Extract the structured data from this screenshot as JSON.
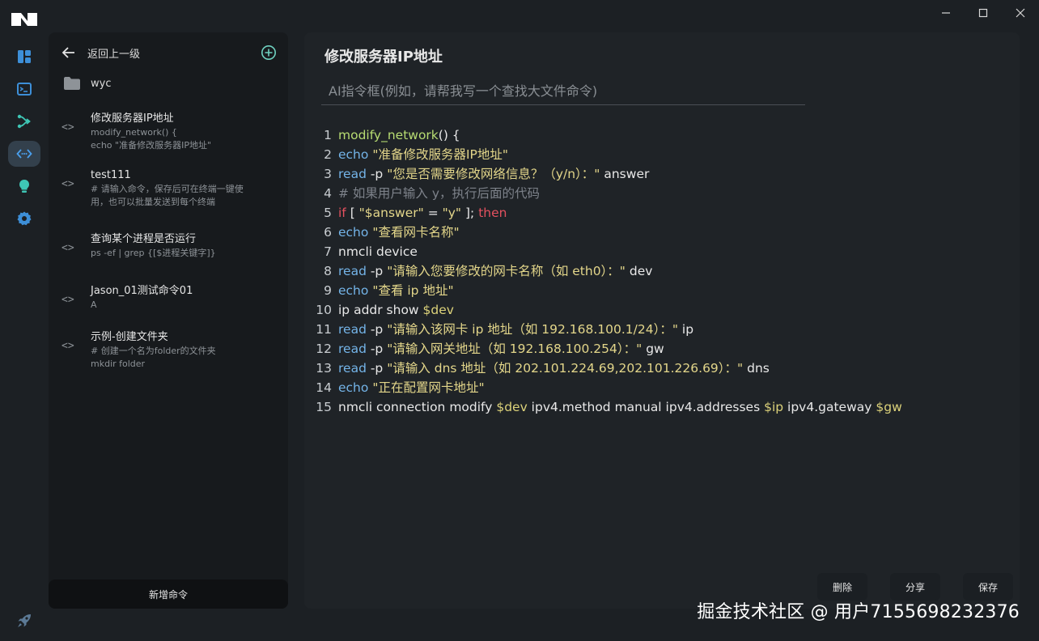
{
  "sidebar": {
    "back_label": "返回上一级",
    "folder_label": "wyc",
    "commands": [
      {
        "title": "修改服务器IP地址",
        "desc1": "modify_network() {",
        "desc2": "echo \"准备修改服务器IP地址\""
      },
      {
        "title": "test111",
        "desc1": "# 请输入命令，保存后可在终端一键使",
        "desc2": "用，也可以批量发送到每个终端"
      },
      {
        "title": "查询某个进程是否运行",
        "desc1": "ps -ef | grep {[$进程关键字]}",
        "desc2": ""
      },
      {
        "title": "Jason_01测试命令01",
        "desc1": "A",
        "desc2": ""
      },
      {
        "title": "示例-创建文件夹",
        "desc1": "# 创建一个名为folder的文件夹",
        "desc2": "mkdir folder"
      }
    ],
    "new_button": "新增命令"
  },
  "editor": {
    "title": "修改服务器IP地址",
    "ai_placeholder": "AI指令框(例如，请帮我写一个查找大文件命令)",
    "line_numbers": [
      "1",
      "2",
      "3",
      "4",
      "5",
      "6",
      "7",
      "8",
      "9",
      "10",
      "11",
      "12",
      "13",
      "14",
      "15"
    ],
    "lines": [
      [
        {
          "t": "fn",
          "s": "modify_network"
        },
        {
          "t": "tx",
          "s": "() {"
        }
      ],
      [
        {
          "t": "kw",
          "s": "echo"
        },
        {
          "t": "tx",
          "s": " "
        },
        {
          "t": "str",
          "s": "\"准备修改服务器IP地址\""
        }
      ],
      [
        {
          "t": "kw",
          "s": "read"
        },
        {
          "t": "tx",
          "s": " -p "
        },
        {
          "t": "str",
          "s": "\"您是否需要修改网络信息？（y/n）：\""
        },
        {
          "t": "tx",
          "s": " answer"
        }
      ],
      [
        {
          "t": "cm",
          "s": "# 如果用户输入 y，执行后面的代码"
        }
      ],
      [
        {
          "t": "red",
          "s": "if"
        },
        {
          "t": "tx",
          "s": " [ "
        },
        {
          "t": "str",
          "s": "\"$answer\""
        },
        {
          "t": "tx",
          "s": " = "
        },
        {
          "t": "str",
          "s": "\"y\""
        },
        {
          "t": "tx",
          "s": " ]; "
        },
        {
          "t": "red",
          "s": "then"
        }
      ],
      [
        {
          "t": "kw",
          "s": "echo"
        },
        {
          "t": "tx",
          "s": " "
        },
        {
          "t": "str",
          "s": "\"查看网卡名称\""
        }
      ],
      [
        {
          "t": "tx",
          "s": "nmcli device"
        }
      ],
      [
        {
          "t": "kw",
          "s": "read"
        },
        {
          "t": "tx",
          "s": " -p "
        },
        {
          "t": "str",
          "s": "\"请输入您要修改的网卡名称（如 eth0）：\""
        },
        {
          "t": "tx",
          "s": " dev"
        }
      ],
      [
        {
          "t": "kw",
          "s": "echo"
        },
        {
          "t": "tx",
          "s": " "
        },
        {
          "t": "str",
          "s": "\"查看 ip 地址\""
        }
      ],
      [
        {
          "t": "tx",
          "s": "ip addr show "
        },
        {
          "t": "var",
          "s": "$dev"
        }
      ],
      [
        {
          "t": "kw",
          "s": "read"
        },
        {
          "t": "tx",
          "s": " -p "
        },
        {
          "t": "str",
          "s": "\"请输入该网卡 ip 地址（如 192.168.100.1/24）：\""
        },
        {
          "t": "tx",
          "s": " ip"
        }
      ],
      [
        {
          "t": "kw",
          "s": "read"
        },
        {
          "t": "tx",
          "s": " -p "
        },
        {
          "t": "str",
          "s": "\"请输入网关地址（如 192.168.100.254）：\""
        },
        {
          "t": "tx",
          "s": " gw"
        }
      ],
      [
        {
          "t": "kw",
          "s": "read"
        },
        {
          "t": "tx",
          "s": " -p "
        },
        {
          "t": "str",
          "s": "\"请输入 dns 地址（如 202.101.224.69,202.101.226.69）：\""
        },
        {
          "t": "tx",
          "s": " dns"
        }
      ],
      [
        {
          "t": "kw",
          "s": "echo"
        },
        {
          "t": "tx",
          "s": " "
        },
        {
          "t": "str",
          "s": "\"正在配置网卡地址\""
        }
      ],
      [
        {
          "t": "tx",
          "s": "nmcli connection modify "
        },
        {
          "t": "var",
          "s": "$dev"
        },
        {
          "t": "tx",
          "s": " ipv4.method manual ipv4.addresses "
        },
        {
          "t": "var",
          "s": "$ip"
        },
        {
          "t": "tx",
          "s": " ipv4.gateway "
        },
        {
          "t": "var",
          "s": "$gw"
        }
      ]
    ]
  },
  "actions": {
    "delete": "删除",
    "share": "分享",
    "save": "保存"
  },
  "watermark": "掘金技术社区 @ 用户7155698232376",
  "colors": {
    "accent": "#3d8fd8",
    "bulb": "#3ec6b5",
    "background": "#1c2024"
  },
  "icons": [
    "app-logo",
    "minimize-icon",
    "maximize-icon",
    "close-icon",
    "dashboard-icon",
    "terminal-icon",
    "share-nodes-icon",
    "code-icon",
    "bulb-icon",
    "gear-icon",
    "rocket-icon",
    "back-arrow-icon",
    "add-circle-icon",
    "folder-icon"
  ]
}
